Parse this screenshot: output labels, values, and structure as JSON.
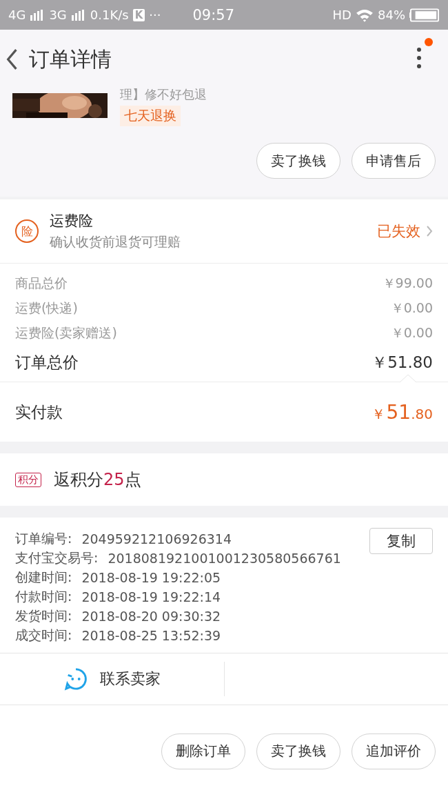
{
  "status_bar": {
    "network_1": "4G",
    "network_2": "3G",
    "speed": "0.1K/s",
    "badge": "K",
    "more": "···",
    "time": "09:57",
    "hd": "HD",
    "battery": "84%"
  },
  "header": {
    "title": "订单详情",
    "has_notification": true
  },
  "product": {
    "title_fragment": "理】修不好包退",
    "tag": "七天退换"
  },
  "product_actions": [
    "卖了换钱",
    "申请售后"
  ],
  "insurance": {
    "icon_text": "险",
    "title": "运费险",
    "subtitle": "确认收货前退货可理赔",
    "status": "已失效"
  },
  "price_rows": [
    {
      "label": "商品总价",
      "value": "￥99.00",
      "kind": "minor"
    },
    {
      "label": "运费(快递)",
      "value": "￥0.00",
      "kind": "minor"
    },
    {
      "label": "运费险(卖家赠送)",
      "value": "￥0.00",
      "kind": "minor"
    },
    {
      "label": "订单总价",
      "value": "￥51.80",
      "kind": "total"
    }
  ],
  "payment": {
    "label": "实付款",
    "currency": "￥",
    "integer": "51",
    "decimal": ".80"
  },
  "points": {
    "badge": "积分",
    "prefix": "返积分",
    "amount": "25",
    "suffix": "点"
  },
  "order_info": [
    {
      "label": "订单编号:",
      "value": "204959212106926314"
    },
    {
      "label": "支付宝交易号:",
      "value": "2018081921001001230580566761"
    },
    {
      "label": "创建时间:",
      "value": "2018-08-19 19:22:05"
    },
    {
      "label": "付款时间:",
      "value": "2018-08-19 19:22:14"
    },
    {
      "label": "发货时间:",
      "value": "2018-08-20 09:30:32"
    },
    {
      "label": "成交时间:",
      "value": "2018-08-25 13:52:39"
    }
  ],
  "copy_button": "复制",
  "contact": {
    "label": "联系卖家"
  },
  "bottom_actions": [
    "删除订单",
    "卖了换钱",
    "追加评价"
  ]
}
